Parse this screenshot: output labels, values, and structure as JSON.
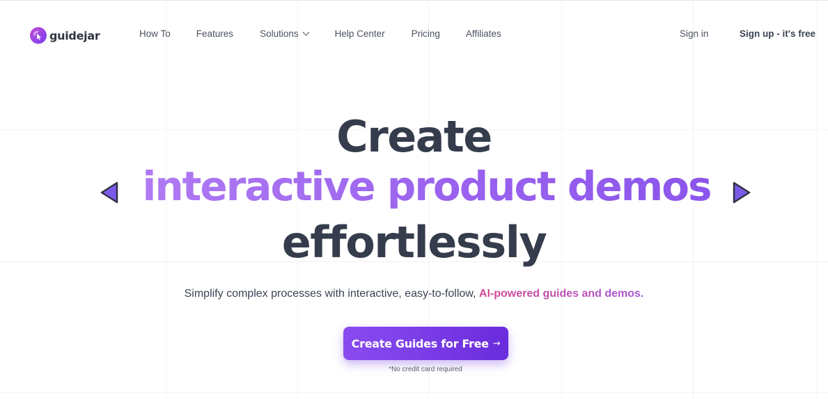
{
  "brand": {
    "name": "guidejar",
    "logo_gradient": [
      "#c24fd6",
      "#7a3cf0"
    ]
  },
  "nav": {
    "links": [
      {
        "label": "How To",
        "has_dropdown": false
      },
      {
        "label": "Features",
        "has_dropdown": false
      },
      {
        "label": "Solutions",
        "has_dropdown": true,
        "icon": "chevron-down-icon"
      },
      {
        "label": "Help Center",
        "has_dropdown": false
      },
      {
        "label": "Pricing",
        "has_dropdown": false
      },
      {
        "label": "Affiliates",
        "has_dropdown": false
      }
    ],
    "sign_in": "Sign in",
    "sign_up": "Sign up - it's free"
  },
  "hero": {
    "line1": "Create",
    "line2": "interactive product demos",
    "line3": "effortlessly",
    "prev_icon": "triangle-left-icon",
    "next_icon": "triangle-right-icon",
    "subtitle_plain": "Simplify complex processes with interactive, easy-to-follow,",
    "subtitle_accent": "AI-powered guides and demos.",
    "cta_label": "Create Guides for Free",
    "cta_icon": "arrow-right-icon",
    "note": "*No credit card required"
  },
  "colors": {
    "heading": "#353c4c",
    "accent_purple": "#a56ef0",
    "accent_pink": "#c04a9a",
    "cta_start": "#8a4cf0",
    "cta_end": "#6a2cdc",
    "arrow_fill": "#7b5ae8"
  }
}
